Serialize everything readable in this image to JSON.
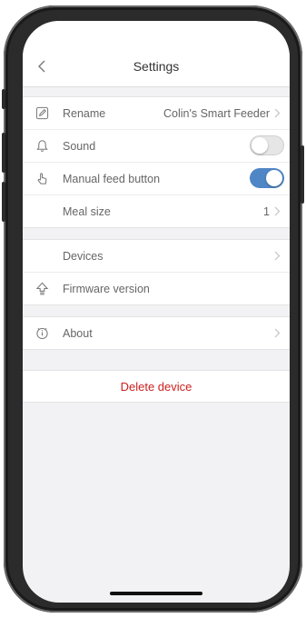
{
  "header": {
    "title": "Settings"
  },
  "group1": {
    "rename": {
      "label": "Rename",
      "value": "Colin's Smart Feeder"
    },
    "sound": {
      "label": "Sound",
      "enabled": false
    },
    "manual_feed": {
      "label": "Manual feed button",
      "enabled": true
    },
    "meal_size": {
      "label": "Meal size",
      "value": "1"
    }
  },
  "group2": {
    "devices": {
      "label": "Devices"
    },
    "firmware": {
      "label": "Firmware version"
    }
  },
  "group3": {
    "about": {
      "label": "About"
    }
  },
  "delete": {
    "label": "Delete device"
  },
  "colors": {
    "accent": "#4f86c6",
    "danger": "#cc1f1f",
    "background": "#f2f2f4"
  },
  "icons": {
    "back": "chevron-left-icon",
    "rename": "edit-icon",
    "sound": "bell-icon",
    "manual_feed": "hand-pointer-icon",
    "firmware": "upload-icon",
    "about": "info-clock-icon",
    "chevron": "chevron-right-icon"
  }
}
